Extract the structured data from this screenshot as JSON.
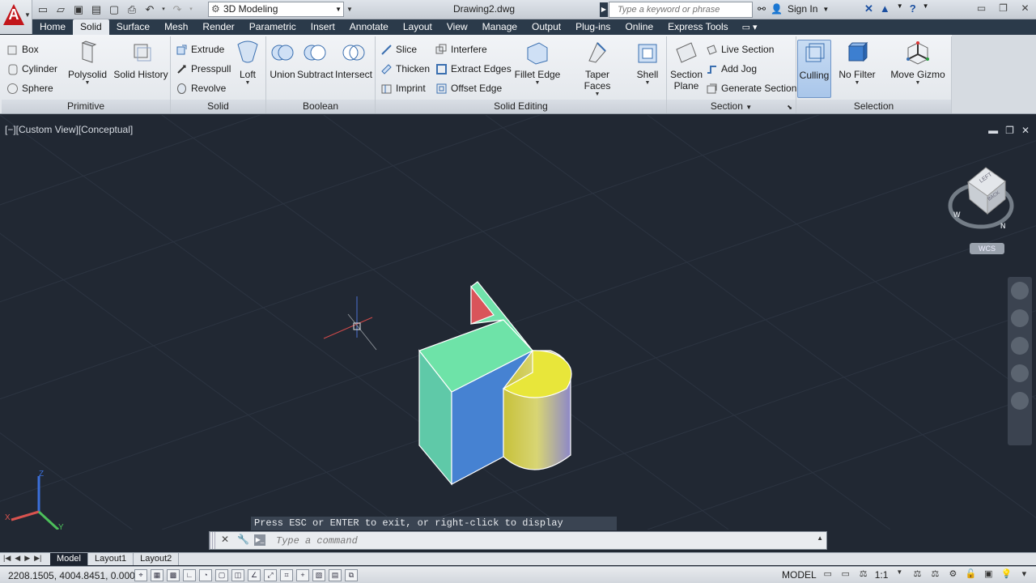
{
  "title_bar": {
    "workspace": "3D Modeling",
    "document_title": "Drawing2.dwg",
    "search_placeholder": "Type a keyword or phrase",
    "sign_in": "Sign In"
  },
  "tabs": [
    "Home",
    "Solid",
    "Surface",
    "Mesh",
    "Render",
    "Parametric",
    "Insert",
    "Annotate",
    "Layout",
    "View",
    "Manage",
    "Output",
    "Plug-ins",
    "Online",
    "Express Tools"
  ],
  "active_tab": "Solid",
  "ribbon": {
    "primitive": {
      "title": "Primitive",
      "box": "Box",
      "cylinder": "Cylinder",
      "sphere": "Sphere",
      "polysolid": "Polysolid",
      "solid_history": "Solid History"
    },
    "solid": {
      "title": "Solid",
      "extrude": "Extrude",
      "presspull": "Presspull",
      "revolve": "Revolve",
      "loft": "Loft"
    },
    "boolean": {
      "title": "Boolean",
      "union": "Union",
      "subtract": "Subtract",
      "intersect": "Intersect"
    },
    "solid_editing": {
      "title": "Solid Editing",
      "slice": "Slice",
      "thicken": "Thicken",
      "imprint": "Imprint",
      "interfere": "Interfere",
      "extract_edges": "Extract Edges",
      "offset_edge": "Offset Edge",
      "fillet_edge": "Fillet Edge",
      "taper_faces": "Taper Faces",
      "shell": "Shell"
    },
    "section": {
      "title": "Section",
      "section_plane_1": "Section",
      "section_plane_2": "Plane",
      "live_section": "Live Section",
      "add_jog": "Add Jog",
      "generate_section": "Generate Section"
    },
    "selection": {
      "title": "Selection",
      "culling": "Culling",
      "no_filter": "No Filter",
      "move_gizmo": "Move Gizmo"
    }
  },
  "viewport": {
    "label": "[−][Custom View][Conceptual]",
    "wcs": "WCS",
    "viewcube_face": "LEFT",
    "viewcube_back": "BACK",
    "compass_w": "W",
    "compass_n": "N",
    "ucs_z": "Z",
    "ucs_y": "Y",
    "ucs_x": "X"
  },
  "command": {
    "message": "Press ESC or ENTER to exit, or right-click to display shortcut-menu.",
    "placeholder": "Type a command"
  },
  "layout_tabs": [
    "Model",
    "Layout1",
    "Layout2"
  ],
  "status_bar": {
    "coordinates": "2208.1505, 4004.8451, 0.0000",
    "model": "MODEL",
    "scale": "1:1"
  },
  "colors": {
    "viewport_bg": "#212833",
    "tab_bar": "#2b3a4a",
    "top_face": "#6ee3a8",
    "left_face": "#62c9a6",
    "front_face": "#4682d2",
    "wedge_red": "#d9545a",
    "cylinder_top": "#e8e63a"
  }
}
